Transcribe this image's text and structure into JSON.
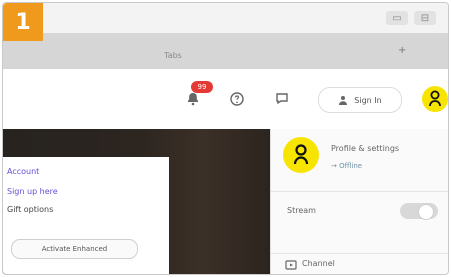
{
  "step": {
    "number": "1"
  },
  "window": {
    "controls": [
      "▭",
      "⊟"
    ]
  },
  "tabbar": {
    "tab_label": "Tabs",
    "more_label": "+"
  },
  "toolbar": {
    "notification_count": "99",
    "sign_in_label": "Sign In"
  },
  "left_card": {
    "line_1": "Account",
    "line_2": "Sign up here",
    "line_3": "Gift options",
    "button_label": "Activate Enhanced"
  },
  "dropdown": {
    "name": "Profile & settings",
    "link": "→ Offline",
    "toggle_label": "Stream",
    "toggle_state": "off",
    "bottom_label": "Channel"
  },
  "colors": {
    "badge": "#ef9a1c",
    "avatar": "#f7e400",
    "accent_purple": "#6150d6",
    "link_blue": "#6f91a6",
    "notification_red": "#e53935"
  },
  "icons": {
    "notifications": "bell-icon",
    "help": "question-icon",
    "messages": "chat-icon",
    "person": "person-icon",
    "channel": "channel-icon"
  }
}
